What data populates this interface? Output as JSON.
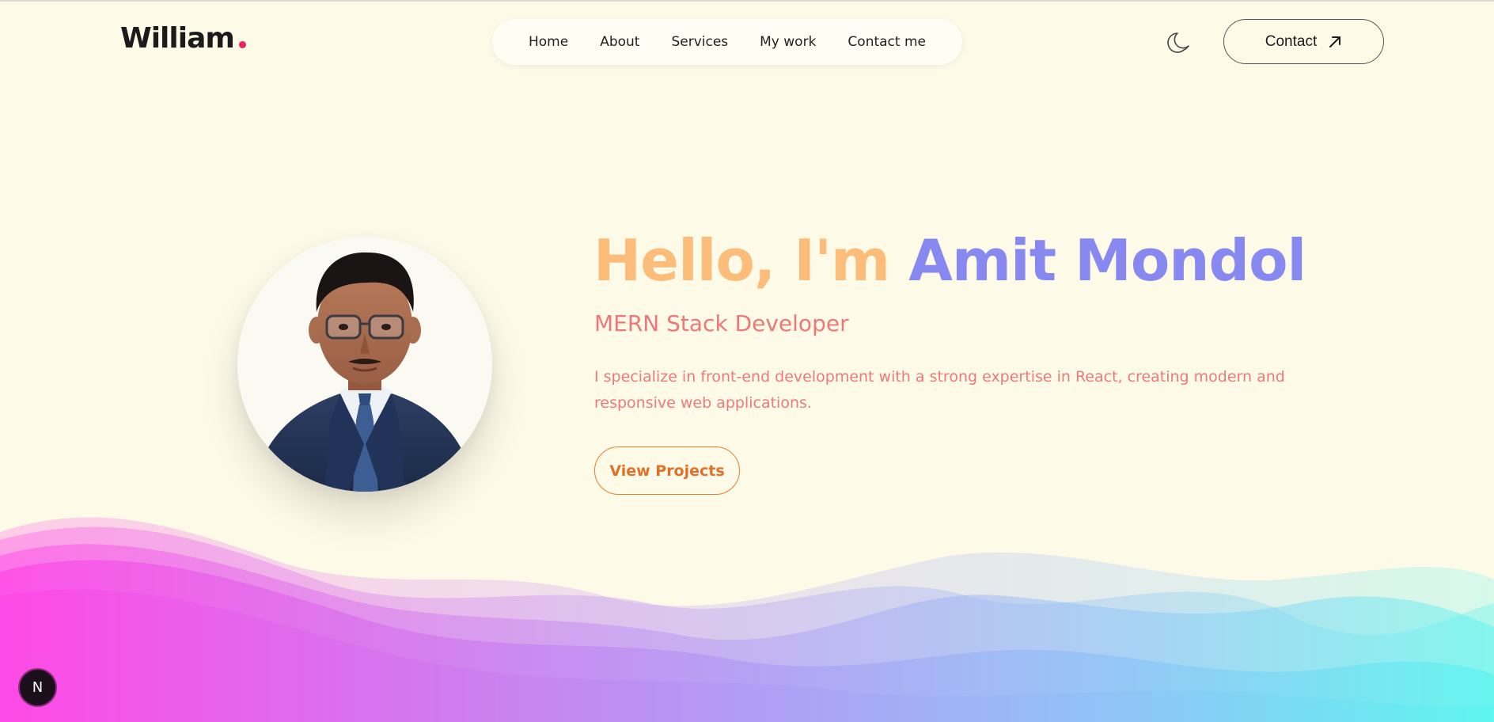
{
  "header": {
    "logo_text": "William",
    "logo_dot_color": "#e8245b",
    "nav": [
      {
        "label": "Home"
      },
      {
        "label": "About"
      },
      {
        "label": "Services"
      },
      {
        "label": "My work"
      },
      {
        "label": "Contact me"
      }
    ],
    "theme_toggle_icon": "moon-icon",
    "contact_label": "Contact",
    "contact_icon": "arrow-up-right-icon"
  },
  "hero": {
    "greeting": "Hello, I'm",
    "name": "Amit Mondol",
    "role": "MERN Stack Developer",
    "description": "I specialize in front-end development with a strong expertise in React, creating modern and responsive web applications.",
    "cta_label": "View Projects",
    "colors": {
      "greeting": "#fcbc7a",
      "name": "#8789f0",
      "role": "#ee7778",
      "cta": "#e0702a"
    }
  },
  "badge": {
    "label": "N"
  }
}
